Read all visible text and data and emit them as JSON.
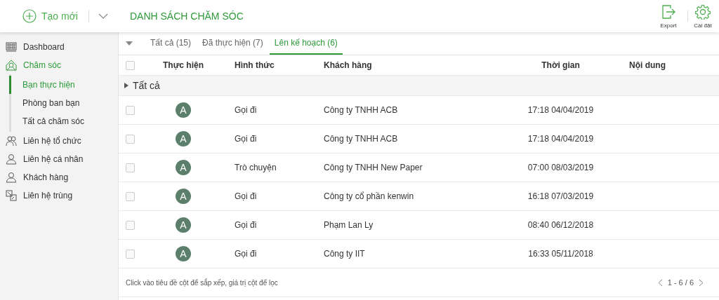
{
  "header": {
    "new_button": "Tạo mới",
    "title": "DANH SÁCH CHĂM SÓC",
    "actions": [
      {
        "label": "Export"
      },
      {
        "label": "Cài đặt"
      }
    ]
  },
  "sidebar": {
    "items": [
      {
        "label": "Dashboard",
        "selected": false
      },
      {
        "label": "Chăm sóc",
        "selected": true,
        "children": [
          {
            "label": "Bạn thực hiện",
            "selected": true
          },
          {
            "label": "Phòng ban bạn",
            "selected": false
          },
          {
            "label": "Tất cả chăm sóc",
            "selected": false
          }
        ]
      },
      {
        "label": "Liên hệ tổ chức",
        "selected": false
      },
      {
        "label": "Liên hệ cá nhân",
        "selected": false
      },
      {
        "label": "Khách hàng",
        "selected": false
      },
      {
        "label": "Liên hệ trùng",
        "selected": false
      }
    ]
  },
  "tabs": [
    {
      "label": "Tất cả (15)",
      "selected": false
    },
    {
      "label": "Đã thực hiện (7)",
      "selected": false
    },
    {
      "label": "Lên kế hoạch (6)",
      "selected": true
    }
  ],
  "table": {
    "columns": [
      "Thực hiện",
      "Hình thức",
      "Khách hàng",
      "Thời gian",
      "Nội dung"
    ],
    "all_checked": false,
    "group": "Tất cả",
    "rows": [
      {
        "checked": false,
        "avatar": "A",
        "type": "Gọi đi",
        "customer": "Công ty TNHH ACB",
        "time": "17:18 04/04/2019"
      },
      {
        "checked": false,
        "avatar": "A",
        "type": "Gọi đi",
        "customer": "Công ty TNHH ACB",
        "time": "17:18 04/04/2019"
      },
      {
        "checked": false,
        "avatar": "A",
        "type": "Trò chuyện",
        "customer": "Công ty TNHH New Paper",
        "time": "07:00 08/03/2019"
      },
      {
        "checked": false,
        "avatar": "A",
        "type": "Gọi đi",
        "customer": "Công ty cổ phần kenwin",
        "time": "16:18 07/03/2019"
      },
      {
        "checked": false,
        "avatar": "A",
        "type": "Gọi đi",
        "customer": "Phạm Lan Ly",
        "time": "08:40 06/12/2018"
      },
      {
        "checked": false,
        "avatar": "A",
        "type": "Gọi đi",
        "customer": "Công ty IIT",
        "time": "16:33 05/11/2018"
      }
    ]
  },
  "footer": {
    "hint": "Click vào tiêu đề cột để sắp xếp, giá trị cột để lọc",
    "pagination": "1 - 6 / 6"
  }
}
